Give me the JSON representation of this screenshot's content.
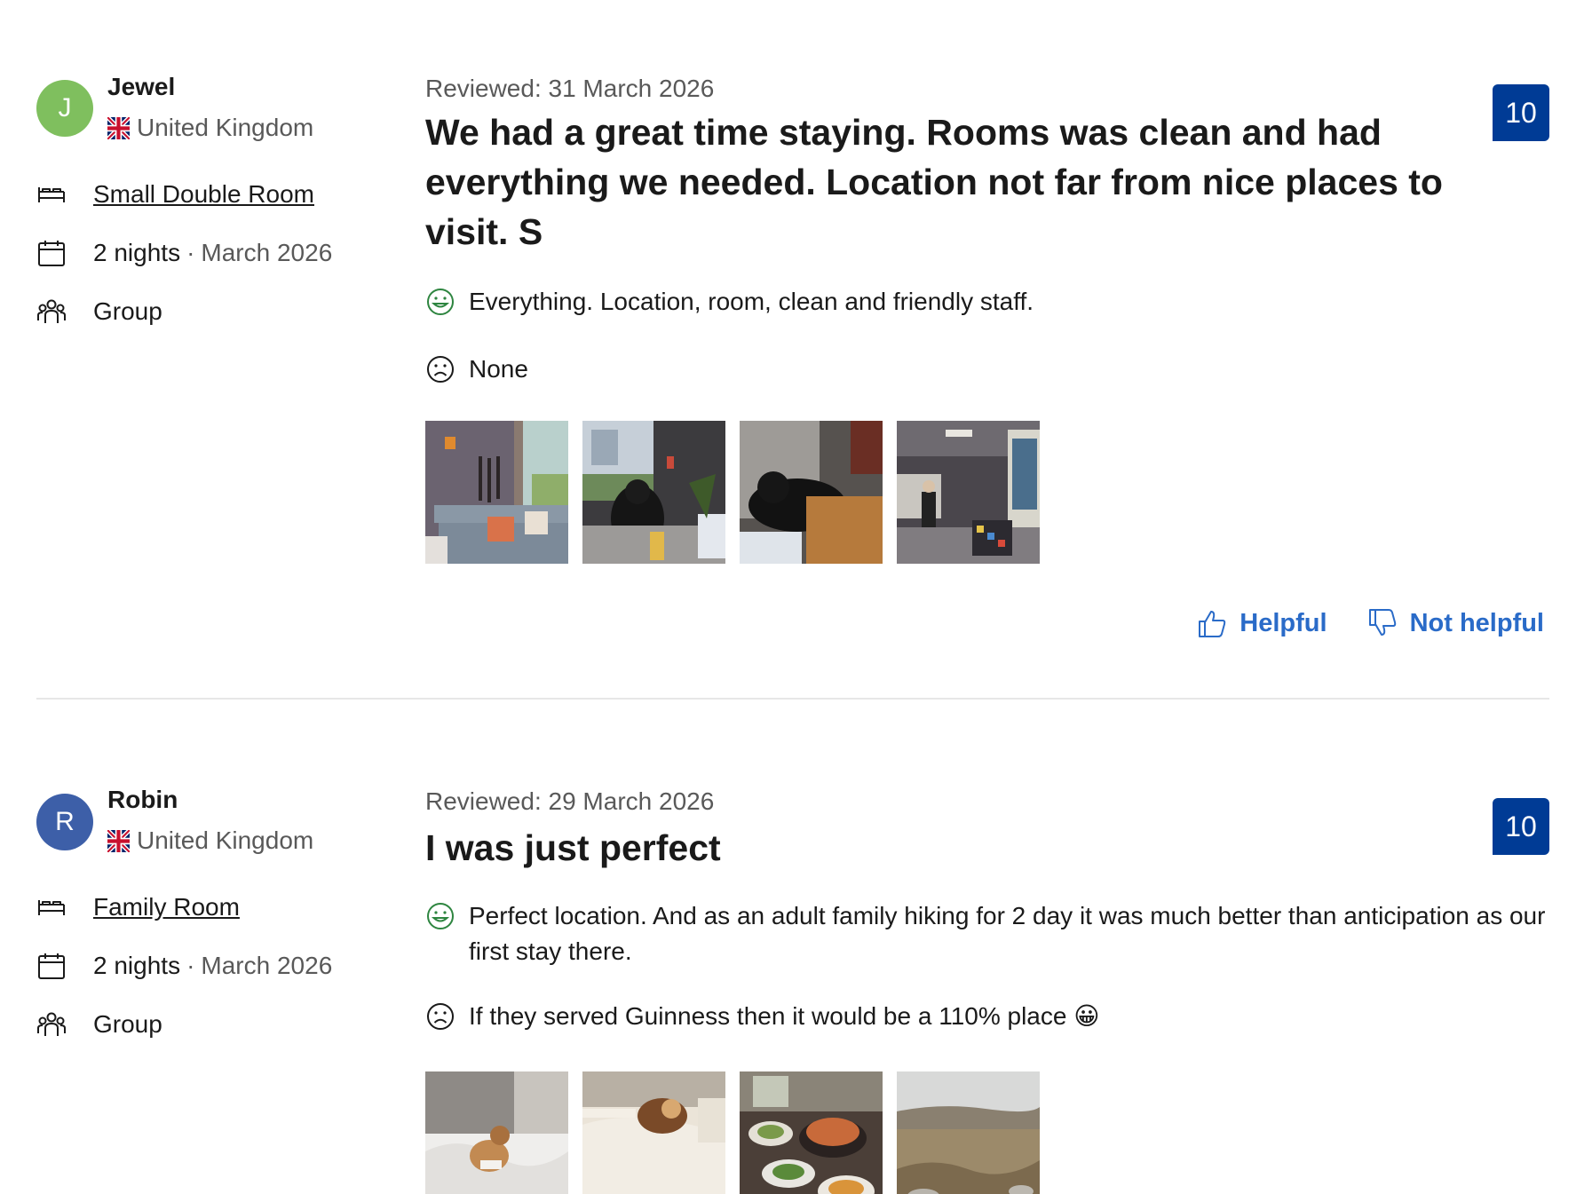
{
  "reviews": [
    {
      "avatar_letter": "J",
      "name": "Jewel",
      "country": "United Kingdom",
      "room": "Small Double Room",
      "nights": "2 nights",
      "stay_separator": "·",
      "stay_month": "March 2026",
      "traveler_type": "Group",
      "reviewed": "Reviewed: 31 March 2026",
      "title": "We had a great time staying. Rooms was clean and had everything we needed. Location not far from nice places to visit. S",
      "score": "10",
      "liked": "Everything. Location, room, clean and friendly staff.",
      "disliked": "None",
      "photo_count": 4
    },
    {
      "avatar_letter": "R",
      "name": "Robin",
      "country": "United Kingdom",
      "room": "Family Room",
      "nights": "2 nights",
      "stay_separator": "·",
      "stay_month": "March 2026",
      "traveler_type": "Group",
      "reviewed": "Reviewed: 29 March 2026",
      "title": "I was just perfect",
      "score": "10",
      "liked": "Perfect location. And as an adult family hiking for 2 day it was much better than anticipation as our first stay there.",
      "disliked": "If they served Guinness then it would be a 110% place 😀",
      "photo_count": 4
    }
  ],
  "actions": {
    "helpful": "Helpful",
    "not_helpful": "Not helpful"
  },
  "colors": {
    "score_bg": "#003b95",
    "link_blue": "#2a6bc8",
    "avatar_green": "#7fbf5e",
    "avatar_blue": "#3d5fa8"
  }
}
